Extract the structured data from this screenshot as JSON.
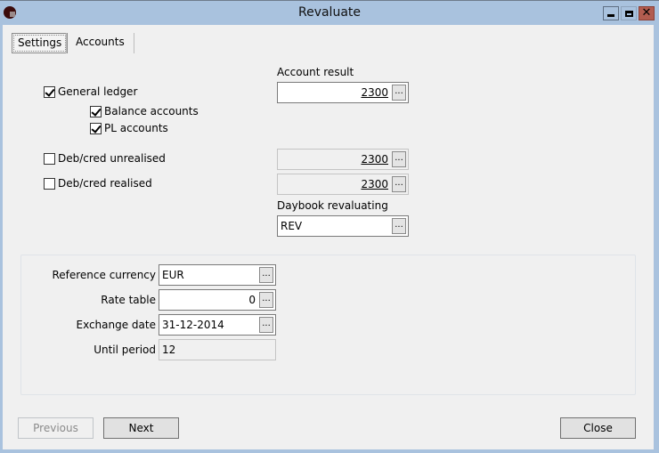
{
  "window": {
    "title": "Revaluate",
    "controls": {
      "minimize": "minimize",
      "maximize": "maximize",
      "close": "✕"
    }
  },
  "tabs": [
    {
      "label": "Settings",
      "active": true
    },
    {
      "label": "Accounts",
      "active": false
    }
  ],
  "checkboxes": {
    "general_ledger": {
      "label": "General ledger",
      "checked": true
    },
    "balance_accounts": {
      "label": "Balance accounts",
      "checked": true
    },
    "pl_accounts": {
      "label": "PL accounts",
      "checked": true
    },
    "debcred_unrealised": {
      "label": "Deb/cred unrealised",
      "checked": false
    },
    "debcred_realised": {
      "label": "Deb/cred realised",
      "checked": false
    }
  },
  "fields": {
    "account_result": {
      "label": "Account result",
      "value": "2300",
      "button": "..."
    },
    "unrealised_account": {
      "value": "2300",
      "button": "..."
    },
    "realised_account": {
      "value": "2300",
      "button": "..."
    },
    "daybook_revaluating": {
      "label": "Daybook revaluating",
      "value": "REV",
      "button": "..."
    }
  },
  "group": {
    "reference_currency": {
      "label": "Reference currency",
      "value": "EUR",
      "button": "..."
    },
    "rate_table": {
      "label": "Rate table",
      "value": "0",
      "button": "..."
    },
    "exchange_date": {
      "label": "Exchange date",
      "value": "31-12-2014",
      "button": "..."
    },
    "until_period": {
      "label": "Until period",
      "value": "12"
    }
  },
  "buttons": {
    "previous": "Previous",
    "next": "Next",
    "close": "Close"
  }
}
